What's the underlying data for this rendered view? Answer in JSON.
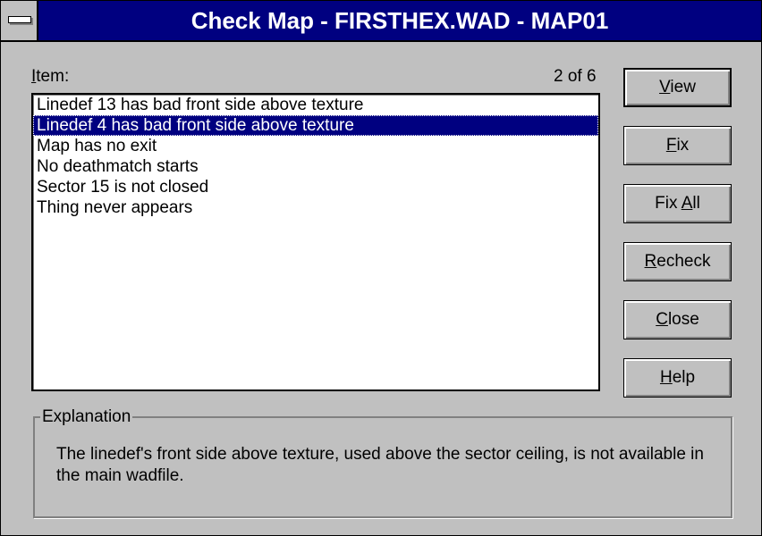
{
  "window": {
    "title": "Check Map - FIRSTHEX.WAD - MAP01"
  },
  "item_label": {
    "accel": "I",
    "rest": "tem:"
  },
  "counter": "2 of 6",
  "list": {
    "selected_index": 1,
    "items": [
      "Linedef 13 has bad front side above texture",
      "Linedef 4 has bad front side above texture",
      "Map has no exit",
      "No deathmatch starts",
      "Sector 15 is not closed",
      "Thing never appears"
    ]
  },
  "buttons": {
    "view": {
      "accel": "V",
      "rest": "iew"
    },
    "fix": {
      "accel": "F",
      "rest": "ix"
    },
    "fix_all": {
      "pre": "Fix ",
      "accel": "A",
      "rest": "ll"
    },
    "recheck": {
      "accel": "R",
      "rest": "echeck"
    },
    "close": {
      "accel": "C",
      "rest": "lose"
    },
    "help": {
      "accel": "H",
      "rest": "elp"
    }
  },
  "explanation": {
    "label": "Explanation",
    "text": "The linedef's front side above texture, used above the sector ceiling, is not available in the main wadfile."
  },
  "colors": {
    "titlebar": "#000080",
    "selection": "#000080",
    "face": "#c0c0c0"
  }
}
